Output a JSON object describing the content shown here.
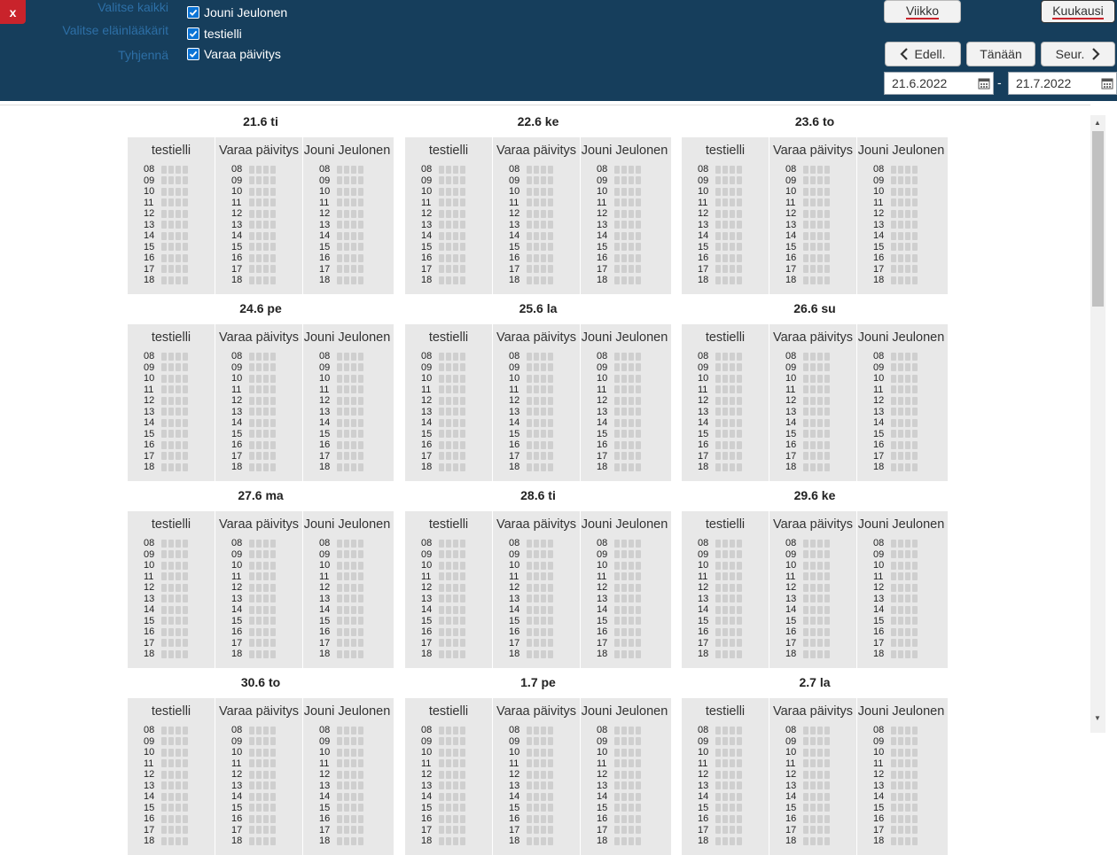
{
  "header": {
    "close_label": "x",
    "links": [
      "Valitse kaikki",
      "Valitse eläinlääkärit",
      "Tyhjennä"
    ],
    "checkboxes": [
      "Jouni Jeulonen",
      "testielli",
      "Varaa päivitys"
    ],
    "view_buttons": {
      "week": "Viikko",
      "month": "Kuukausi"
    },
    "nav": {
      "prev": "Edell.",
      "today": "Tänään",
      "next": "Seur."
    },
    "date_from": "21.6.2022",
    "date_sep": "-",
    "date_to": "21.7.2022"
  },
  "columns": [
    "testielli",
    "Varaa päivitys",
    "Jouni Jeulonen"
  ],
  "hours": [
    "08",
    "09",
    "10",
    "11",
    "12",
    "13",
    "14",
    "15",
    "16",
    "17",
    "18"
  ],
  "days": [
    "21.6 ti",
    "22.6 ke",
    "23.6 to",
    "24.6 pe",
    "25.6 la",
    "26.6 su",
    "27.6 ma",
    "28.6 ti",
    "29.6 ke",
    "30.6 to",
    "1.7 pe",
    "2.7 la"
  ],
  "colors": {
    "header_bg": "#163e5c",
    "link": "#2d6fa6",
    "close": "#c9232b",
    "panel": "#e8e8e8",
    "slot": "#cfcfcf"
  }
}
